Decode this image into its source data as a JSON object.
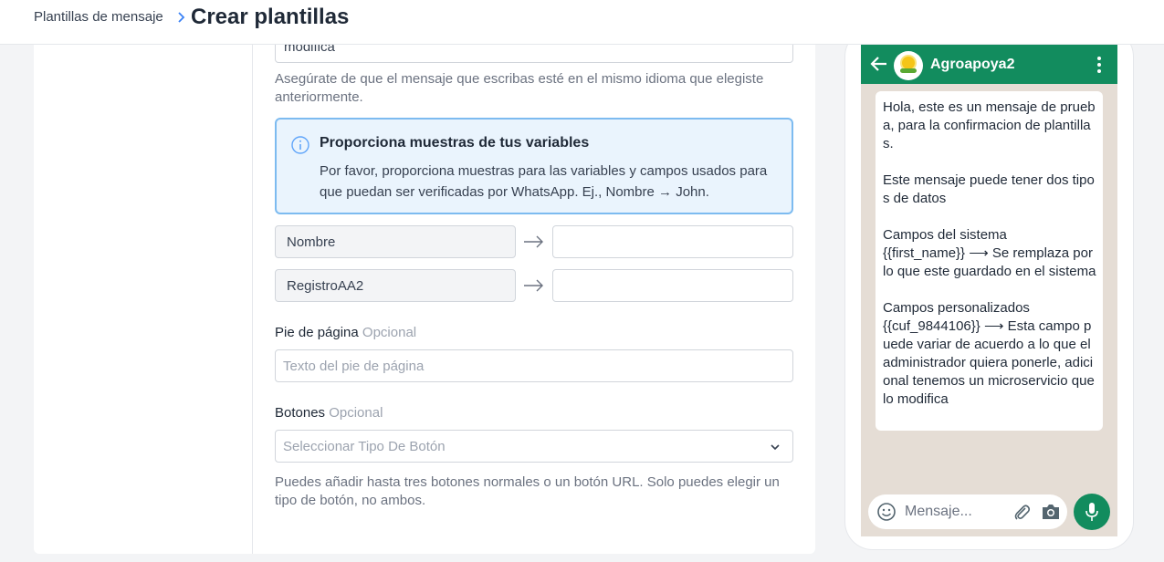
{
  "breadcrumb": {
    "parent": "Plantillas de mensaje",
    "current": "Crear plantillas"
  },
  "form": {
    "body_value_tail": "modifica",
    "language_help": "Asegúrate de que el mensaje que escribas esté en el mismo idioma que elegiste anteriormente.",
    "info": {
      "title": "Proporciona muestras de tus variables",
      "text": "Por favor, proporciona muestras para las variables y campos usados para que puedan ser verificadas por WhatsApp. Ej., Nombre → John."
    },
    "variables": [
      {
        "name": "Nombre",
        "sample": ""
      },
      {
        "name": "RegistroAA2",
        "sample": ""
      }
    ],
    "footer": {
      "label": "Pie de página",
      "optional": "Opcional",
      "placeholder": "Texto del pie de página"
    },
    "buttons": {
      "label": "Botones",
      "optional": "Opcional",
      "select_placeholder": "Seleccionar Tipo De Botón",
      "help": "Puedes añadir hasta tres botones normales o un botón URL. Solo puedes elegir un tipo de botón, no ambos."
    }
  },
  "preview": {
    "contact_name": "Agroapoya2",
    "message": "Hola, este es un mensaje de prueba, para la confirmacion de plantillas.\n\nEste mensaje puede tener dos tipos de datos\n\nCampos del sistema\n{{first_name}} ⟶ Se remplaza por lo que este guardado en el sistema\n\nCampos personalizados\n{{cuf_9844106}} ⟶ Esta campo puede variar de acuerdo a lo que el administrador quiera ponerle, adicional tenemos un microservicio que lo modifica",
    "compose_placeholder": "Mensaje..."
  },
  "colors": {
    "whatsapp_green": "#128c5e",
    "info_border": "#7dbbf0",
    "info_bg": "#eaf4fd",
    "chat_bg": "#e5ddd5"
  },
  "icons": [
    "chevron-right-icon",
    "info-icon",
    "arrow-right-icon",
    "chevron-down-icon",
    "back-arrow-icon",
    "more-vertical-icon",
    "emoji-icon",
    "paperclip-icon",
    "camera-icon",
    "microphone-icon"
  ]
}
